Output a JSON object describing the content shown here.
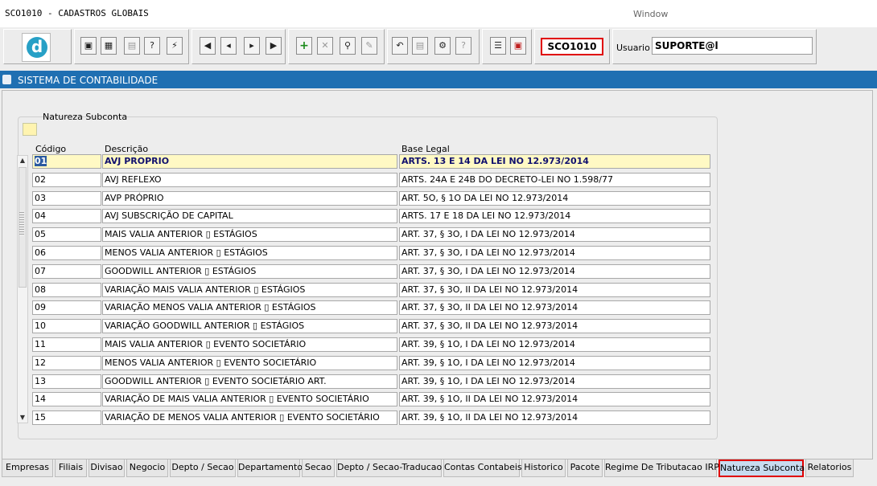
{
  "window": {
    "title": "SCO1010 - CADASTROS GLOBAIS",
    "menu": "Window"
  },
  "toolbar": {
    "logo_letter": "d",
    "form_code": "SCO1010",
    "user_label": "Usuario",
    "user_value": "SUPORTE@l"
  },
  "section": {
    "title": "SISTEMA DE CONTABILIDADE"
  },
  "block": {
    "legend": "Natureza Subconta",
    "columns": [
      "Código",
      "Descrição",
      "Base Legal"
    ],
    "rows": [
      {
        "codigo": "01",
        "descricao": "AVJ PROPRIO",
        "base": "ARTS. 13 E 14 DA LEI NO 12.973/2014"
      },
      {
        "codigo": "02",
        "descricao": "AVJ REFLEXO",
        "base": "ARTS. 24A E 24B DO DECRETO-LEI NO 1.598/77"
      },
      {
        "codigo": "03",
        "descricao": "AVP PRÓPRIO",
        "base": "ART. 5O, § 1O DA LEI NO 12.973/2014"
      },
      {
        "codigo": "04",
        "descricao": "AVJ SUBSCRIÇÃO DE CAPITAL",
        "base": "ARTS. 17 E 18 DA LEI NO 12.973/2014"
      },
      {
        "codigo": "05",
        "descricao": "MAIS VALIA ANTERIOR ▯ ESTÁGIOS",
        "base": "ART. 37, § 3O, I DA LEI NO 12.973/2014"
      },
      {
        "codigo": "06",
        "descricao": "MENOS VALIA ANTERIOR ▯ ESTÁGIOS",
        "base": "ART. 37, § 3O, I DA LEI NO 12.973/2014"
      },
      {
        "codigo": "07",
        "descricao": "GOODWILL ANTERIOR ▯ ESTÁGIOS",
        "base": "ART. 37, § 3O, I DA LEI NO 12.973/2014"
      },
      {
        "codigo": "08",
        "descricao": "VARIAÇÃO MAIS VALIA ANTERIOR ▯ ESTÁGIOS",
        "base": "ART. 37, § 3O, II DA LEI NO 12.973/2014"
      },
      {
        "codigo": "09",
        "descricao": "VARIAÇÃO MENOS VALIA ANTERIOR ▯ ESTÁGIOS",
        "base": "ART. 37, § 3O, II DA LEI NO 12.973/2014"
      },
      {
        "codigo": "10",
        "descricao": "VARIAÇÃO GOODWILL ANTERIOR ▯ ESTÁGIOS",
        "base": "ART. 37, § 3O, II DA LEI NO 12.973/2014"
      },
      {
        "codigo": "11",
        "descricao": "MAIS VALIA ANTERIOR ▯ EVENTO SOCIETÁRIO",
        "base": "ART. 39, § 1O, I DA LEI NO 12.973/2014"
      },
      {
        "codigo": "12",
        "descricao": "MENOS VALIA ANTERIOR ▯ EVENTO SOCIETÁRIO",
        "base": "ART. 39, § 1O, I DA LEI NO 12.973/2014"
      },
      {
        "codigo": "13",
        "descricao": "GOODWILL ANTERIOR ▯ EVENTO SOCIETÁRIO    ART.",
        "base": "ART. 39, § 1O, I DA LEI NO 12.973/2014"
      },
      {
        "codigo": "14",
        "descricao": "VARIAÇÃO DE MAIS VALIA ANTERIOR ▯ EVENTO SOCIETÁRIO",
        "base": "ART. 39, § 1O, II DA LEI NO 12.973/2014"
      },
      {
        "codigo": "15",
        "descricao": "VARIAÇÃO DE MENOS VALIA ANTERIOR ▯ EVENTO SOCIETÁRIO",
        "base": "ART. 39, § 1O, II DA LEI NO 12.973/2014"
      }
    ]
  },
  "tabs": [
    "Empresas",
    "Filiais",
    "Divisao",
    "Negocio",
    "Depto / Secao",
    "Departamento",
    "Secao",
    "Depto / Secao-Traducao",
    "Contas Contabeis",
    "Historico",
    "Pacote",
    "Regime De Tributacao IRPJ",
    "Natureza Subconta",
    "Relatorios"
  ],
  "active_tab": "Natureza Subconta",
  "colors": {
    "section_bar": "#1f6fb2",
    "highlight": "#e00000",
    "selected_row": "#fff9c4"
  }
}
